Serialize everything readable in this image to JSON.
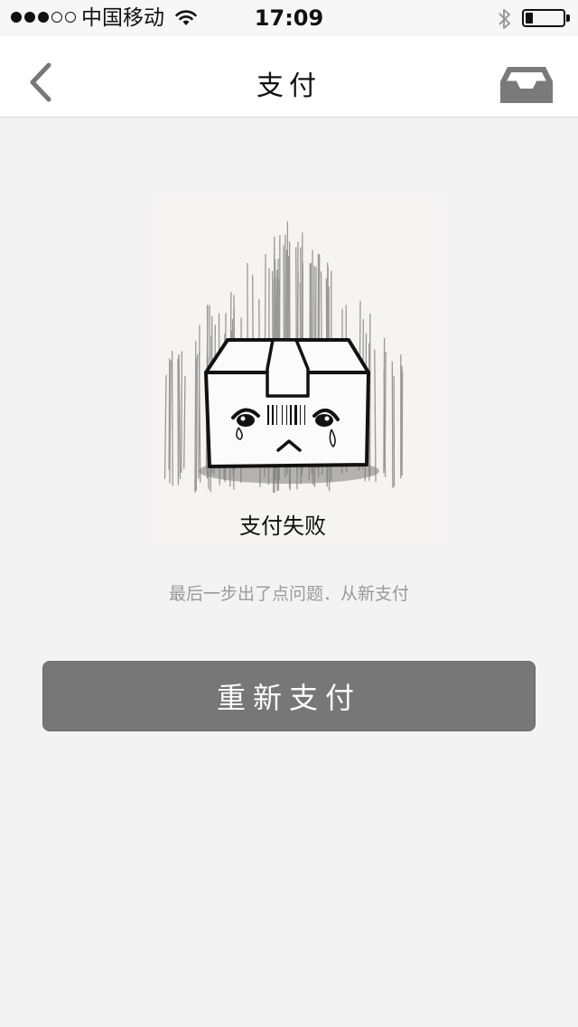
{
  "status_bar": {
    "carrier": "中国移动",
    "time": "17:09",
    "signal_bars": 3,
    "signal_total": 5,
    "battery_level": 0.2
  },
  "nav": {
    "title": "支付",
    "back_icon": "chevron-left-icon",
    "right_icon": "inbox-tray-icon"
  },
  "content": {
    "fail_title": "支付失败",
    "fail_description": "最后一步出了点问题．从新支付",
    "illustration_icon": "sad-box-icon"
  },
  "actions": {
    "retry_label": "重新支付"
  },
  "colors": {
    "background": "#f3f3f3",
    "button": "#777777",
    "muted_text": "#9a9a9a"
  }
}
